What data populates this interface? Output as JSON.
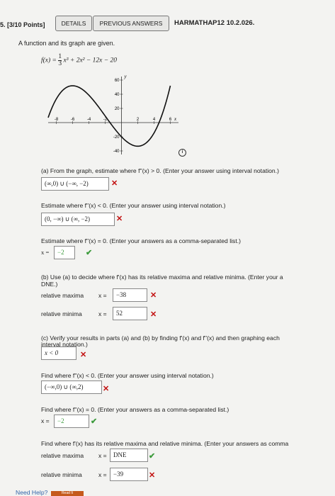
{
  "header": {
    "question_number": "5. [3/10 Points]",
    "details_label": "DETAILS",
    "previous_answers_label": "PREVIOUS ANSWERS",
    "course_code": "HARMATHAP12 10.2.026."
  },
  "problem": {
    "intro": "A function and its graph are given.",
    "function_lhs": "f(x) = ",
    "function_rhs": "x³ + 2x² − 12x − 20",
    "fraction_num": "1",
    "fraction_den": "3"
  },
  "graph": {
    "y_label": "y",
    "x_label": "x",
    "x_ticks": [
      "-8",
      "-6",
      "-4",
      "-2",
      "2",
      "4",
      "6"
    ],
    "y_ticks": [
      "60",
      "40",
      "20",
      "-20",
      "-40"
    ]
  },
  "chart_data": {
    "type": "line",
    "title": "",
    "xlabel": "x",
    "ylabel": "y",
    "xlim": [
      -9,
      7
    ],
    "ylim": [
      -45,
      65
    ],
    "series": [
      {
        "x": [
          -9,
          -8,
          -7,
          -6,
          -5,
          -4,
          -3,
          -2,
          -1,
          0,
          1,
          2,
          3,
          4,
          5,
          6
        ],
        "values": [
          -29,
          7.33,
          33.67,
          52,
          63.33,
          68.67,
          61,
          47.33,
          21.67,
          -20,
          -29.67,
          -33.33,
          -29,
          -14.67,
          11.67,
          52
        ]
      }
    ]
  },
  "part_a": {
    "prompt": "(a) From the graph, estimate where f''(x) > 0. (Enter your answer using interval notation.)",
    "answer1": "(∞,0) ∪ (−∞, −2)",
    "prompt2": "Estimate where f''(x) < 0. (Enter your answer using interval notation.)",
    "answer2": "(0, −∞) ∪ (∞, −2)",
    "prompt3": "Estimate where f''(x) = 0. (Enter your answers as a comma-separated list.)",
    "x_eq": "x =",
    "answer3": "−2"
  },
  "part_b": {
    "prompt": "(b) Use (a) to decide where f'(x) has its relative maxima and relative minima. (Enter your a",
    "prompt_cont": "DNE.)",
    "max_label": "relative maxima",
    "max_x_eq": "x =",
    "max_answer": "−38",
    "min_label": "relative minima",
    "min_x_eq": "x =",
    "min_answer": "52"
  },
  "part_c": {
    "prompt": "(c) Verify your results in parts (a) and (b) by finding f'(x) and f''(x) and then graphing each",
    "prompt_cont": "interval notation.)",
    "answer1": "x < 0",
    "prompt2": "Find where f''(x) < 0. (Enter your answer using interval notation.)",
    "answer2": "(−∞,0) ∪ (∞,2)",
    "prompt3": "Find where f''(x) = 0. (Enter your answers as a comma-separated list.)",
    "x_eq": "x =",
    "answer3": "−2",
    "prompt4": "Find where f'(x) has its relative maxima and relative minima. (Enter your answers as comma",
    "max_label": "relative maxima",
    "max_x_eq": "x =",
    "max_answer": "DNE",
    "min_label": "relative minima",
    "min_x_eq": "x =",
    "min_answer": "−39"
  },
  "footer": {
    "need_help": "Need Help?",
    "read_it": "Read It"
  },
  "colors": {
    "correct": "#3c9b3c",
    "incorrect": "#c21010",
    "help_button": "#c55a1c"
  }
}
